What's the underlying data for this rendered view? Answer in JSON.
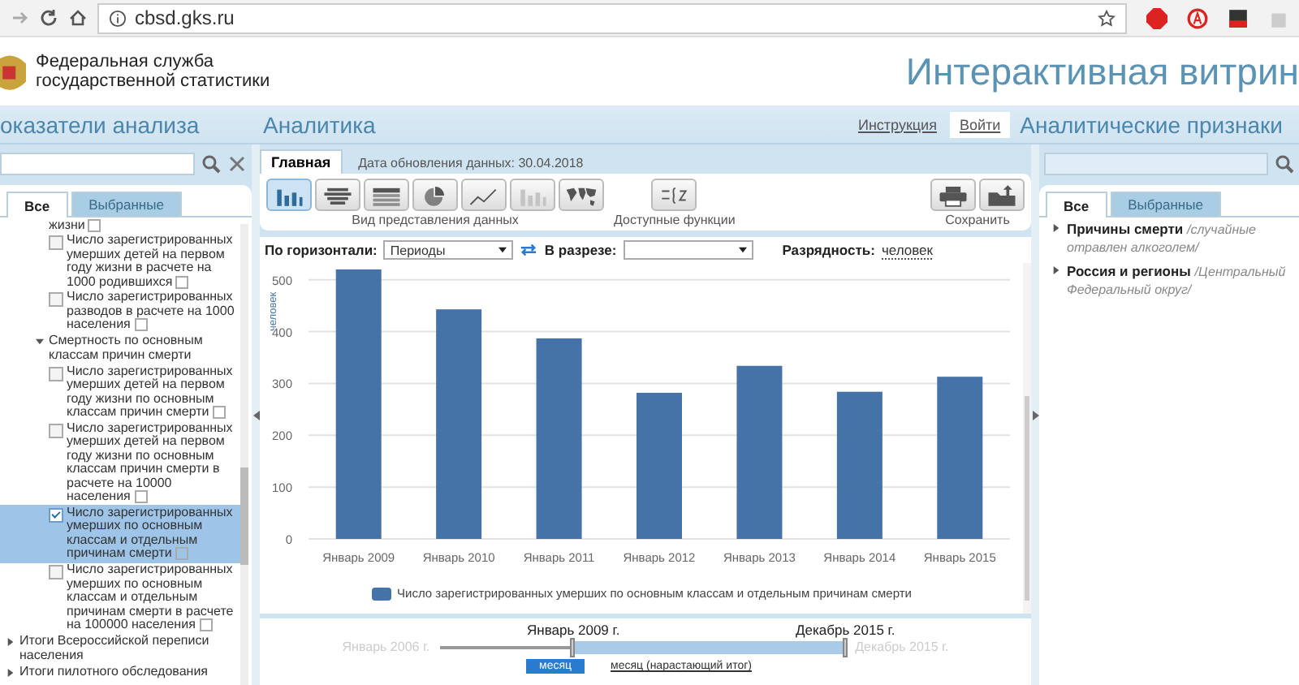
{
  "browser": {
    "url": "cbsd.gks.ru"
  },
  "header": {
    "org_lines": [
      "Федеральная служба",
      "государственной статистики"
    ],
    "title": "Интерактивная витрин"
  },
  "nav": {
    "left_title": "оказатели анализа",
    "center_title": "Аналитика",
    "links": [
      "Инструкция",
      "Войти"
    ],
    "right_title": "Аналитические признаки"
  },
  "left_panel": {
    "tabs": [
      {
        "label": "Все",
        "selected": true
      },
      {
        "label": "Выбранные",
        "selected": false
      }
    ],
    "tree": [
      {
        "kind": "tail",
        "label": "жизни"
      },
      {
        "kind": "indicator",
        "label": "Число зарегистрированных умерших детей на первом году жизни в расчете на 1000 родившихся",
        "checked": false,
        "selected": false
      },
      {
        "kind": "indicator",
        "label": "Число зарегистрированных разводов в расчете на 1000 населения",
        "checked": false,
        "selected": false
      },
      {
        "kind": "group",
        "label": "Смертность по основным классам причин смерти",
        "expanded": true,
        "children": [
          {
            "kind": "indicator",
            "label": "Число зарегистрированных умерших детей на первом году жизни по основным классам причин смерти",
            "checked": false,
            "selected": false
          },
          {
            "kind": "indicator",
            "label": "Число зарегистрированных умерших детей на первом году жизни по основным классам причин смерти в расчете на 10000 населения",
            "checked": false,
            "selected": false
          },
          {
            "kind": "indicator",
            "label": "Число зарегистрированных умерших по основным классам и отдельным причинам смерти",
            "checked": true,
            "selected": true
          },
          {
            "kind": "indicator",
            "label": "Число зарегистрированных умерших по основным классам и отдельным причинам смерти в расчете на 100000 населения",
            "checked": false,
            "selected": false
          }
        ]
      },
      {
        "kind": "section",
        "label": "Итоги Всероссийской переписи населения",
        "expanded": false
      },
      {
        "kind": "section",
        "label": "Итоги пилотного обследования",
        "expanded": false
      }
    ]
  },
  "center": {
    "tabs": [
      {
        "label": "Главная",
        "selected": true
      }
    ],
    "update_date": "Дата обновления данных: 30.04.2018",
    "toolbar": [
      {
        "label": "Вид представления данных",
        "buttons": [
          {
            "kind": "columns",
            "selected": true,
            "disabled": false
          },
          {
            "kind": "stacked",
            "selected": false,
            "disabled": false
          },
          {
            "kind": "table",
            "selected": false,
            "disabled": false
          },
          {
            "kind": "pie",
            "selected": false,
            "disabled": false
          },
          {
            "kind": "line",
            "selected": false,
            "disabled": false
          },
          {
            "kind": "columns",
            "selected": false,
            "disabled": true
          },
          {
            "kind": "map",
            "selected": false,
            "disabled": false
          }
        ]
      },
      {
        "label": "Доступные функции",
        "buttons": [
          {
            "kind": "formula",
            "selected": false,
            "disabled": false
          }
        ]
      },
      {
        "label": "Сохранить",
        "buttons": [
          {
            "kind": "print",
            "selected": false,
            "disabled": false
          },
          {
            "kind": "export",
            "selected": false,
            "disabled": false
          }
        ]
      }
    ],
    "controls": {
      "horizontal_label": "По горизонтали:",
      "horizontal_value": "Периоды",
      "slice_label": "В разрезе:",
      "unit_label": "Разрядность:",
      "unit_value": "человек"
    },
    "chart_data": {
      "type": "bar",
      "ylabel": "человек",
      "categories": [
        "Январь 2009",
        "Январь 2010",
        "Январь 2011",
        "Январь 2012",
        "Январь 2013",
        "Январь 2014",
        "Январь 2015"
      ],
      "series": [
        {
          "name": "Число зарегистрированных умерших по основным классам и отдельным причинам смерти",
          "color": "#4572a7",
          "values": [
            520,
            443,
            387,
            282,
            334,
            284,
            313
          ]
        }
      ],
      "grid": true,
      "ylim": [
        0,
        520
      ],
      "yticks": [
        0,
        100,
        200,
        300,
        400,
        500
      ]
    },
    "timeline": {
      "min_label": "Январь 2006 г.",
      "max_label": "Декабрь 2015 г.",
      "handles": [
        {
          "label": "Январь 2009 г.",
          "level": 0.33
        },
        {
          "label": "Декабрь 2015 г.",
          "level": 1
        }
      ],
      "modes": [
        {
          "label": "месяц",
          "selected": true
        },
        {
          "label": "месяц (нарастающий итог)",
          "selected": false
        }
      ]
    }
  },
  "right_panel": {
    "tabs": [
      {
        "label": "Все",
        "selected": true
      },
      {
        "label": "Выбранные",
        "selected": false
      }
    ],
    "items": [
      {
        "name": "Причины смерти",
        "detail": "/случайные отравлен алкоголем/"
      },
      {
        "name": "Россия и регионы",
        "detail": "/Центральный Федеральный округ/"
      }
    ]
  }
}
